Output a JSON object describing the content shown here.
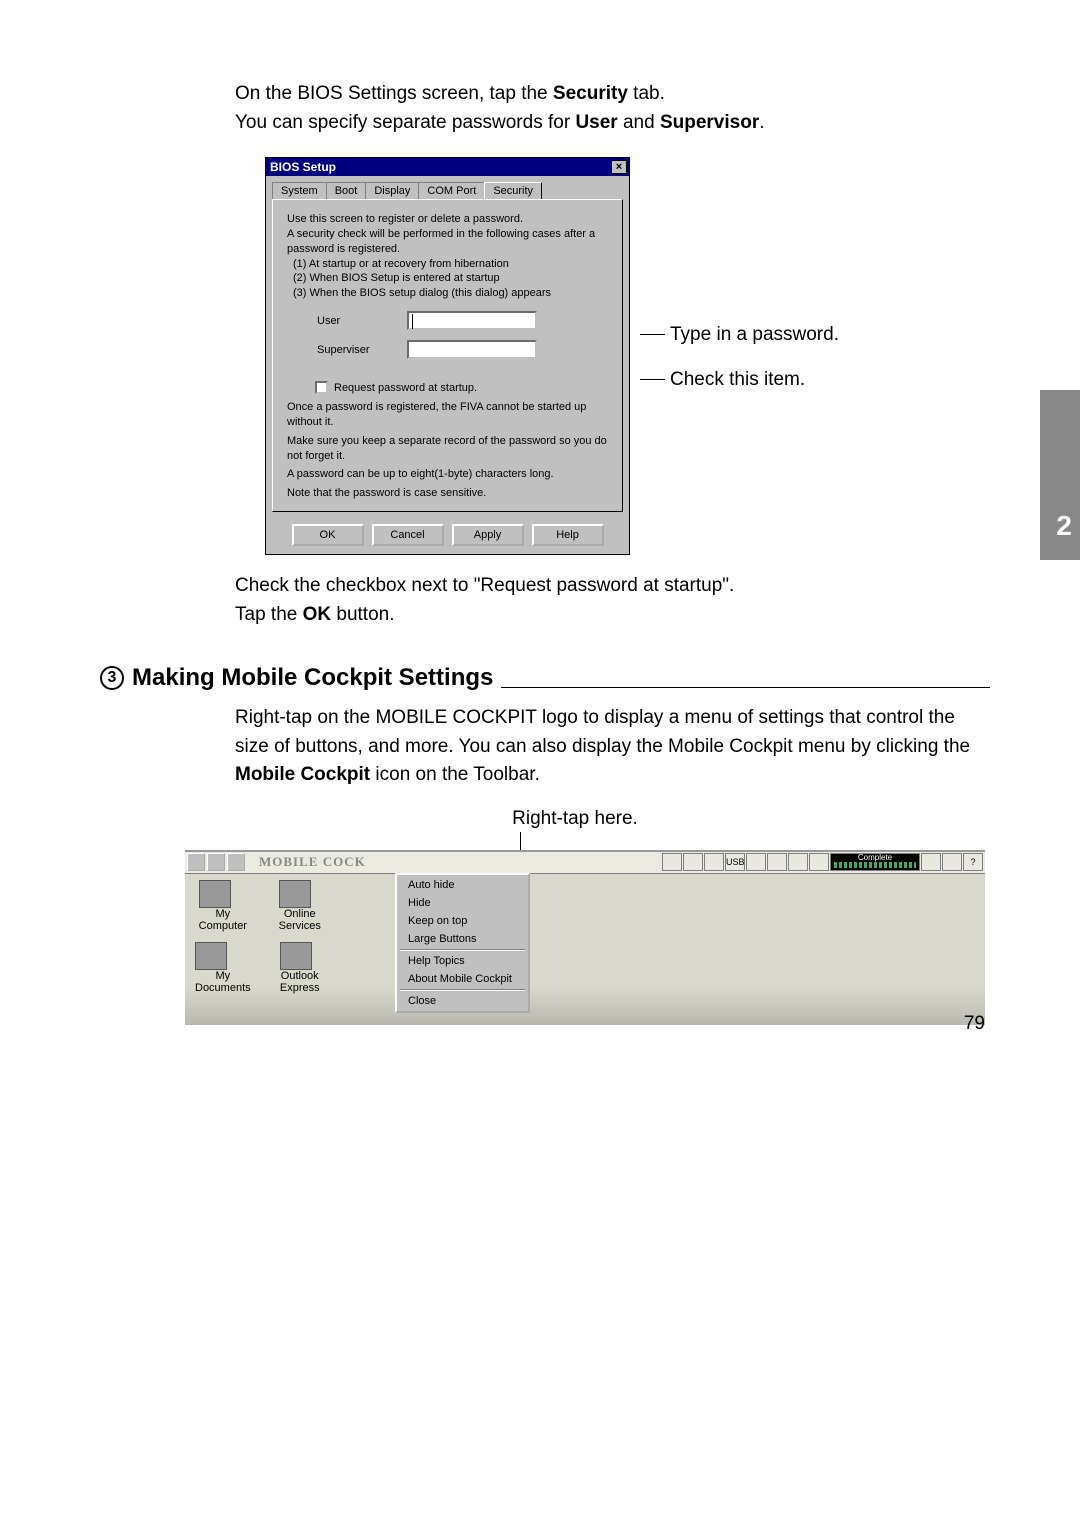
{
  "intro": {
    "line1_pre": "On the BIOS Settings screen, tap the ",
    "line1_bold": "Security",
    "line1_post": " tab.",
    "line2_pre": "You can specify separate passwords for ",
    "line2_b1": "User",
    "line2_mid": " and ",
    "line2_b2": "Supervisor",
    "line2_post": "."
  },
  "bios": {
    "title": "BIOS Setup",
    "tabs": [
      "System",
      "Boot",
      "Display",
      "COM Port",
      "Security"
    ],
    "desc": {
      "l1": "Use this screen to register or delete a password.",
      "l2": "A security check will be performed in the following cases after a password is registered.",
      "l3": "(1) At startup or at recovery from hibernation",
      "l4": "(2) When BIOS Setup is entered at startup",
      "l5": "(3) When the BIOS setup dialog (this dialog) appears"
    },
    "user_label": "User",
    "supervisor_label": "Superviser",
    "checkbox_label": "Request password at startup.",
    "warn1": "Once a password is registered, the FIVA cannot be started up without it.",
    "warn2": "Make sure you keep a separate record of the password so you do not forget it.",
    "warn3": "A password can be up to eight(1-byte)  characters long.",
    "warn4": "Note that the password is case sensitive.",
    "buttons": {
      "ok": "OK",
      "cancel": "Cancel",
      "apply": "Apply",
      "help": "Help"
    }
  },
  "annotations": {
    "type_password": "Type in a password.",
    "check_item": "Check this item."
  },
  "after": {
    "l1": "Check the checkbox next to \"Request password at startup\".",
    "l2_pre": "Tap the ",
    "l2_bold": "OK",
    "l2_post": " button."
  },
  "section": {
    "num": "3",
    "title": "Making Mobile Cockpit Settings",
    "body_pre": "Right-tap on the MOBILE COCKPIT logo to display a menu of settings that control the size of buttons, and more. You can also display the Mobile Cockpit menu by clicking the ",
    "body_bold": "Mobile Cockpit",
    "body_post": " icon on the Toolbar.",
    "right_tap": "Right-tap here."
  },
  "cockpit": {
    "logo": "MOBILE COCK",
    "complete": "Complete",
    "menu": [
      "Auto hide",
      "Hide",
      "Keep on top",
      "Large Buttons",
      "Help Topics",
      "About Mobile Cockpit",
      "Close"
    ],
    "icons": {
      "mycomputer": "My Computer",
      "online": "Online Services",
      "mydocs": "My Documents",
      "outlook": "Outlook Express"
    }
  },
  "side_tab": "2",
  "page_num": "79"
}
